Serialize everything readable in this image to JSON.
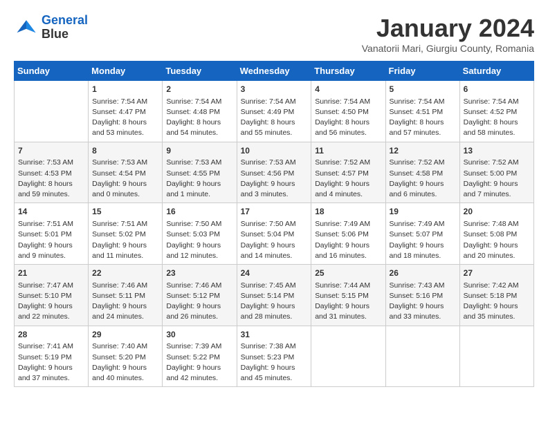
{
  "logo": {
    "line1": "General",
    "line2": "Blue"
  },
  "title": "January 2024",
  "location": "Vanatorii Mari, Giurgiu County, Romania",
  "weekdays": [
    "Sunday",
    "Monday",
    "Tuesday",
    "Wednesday",
    "Thursday",
    "Friday",
    "Saturday"
  ],
  "weeks": [
    [
      {
        "day": "",
        "info": ""
      },
      {
        "day": "1",
        "info": "Sunrise: 7:54 AM\nSunset: 4:47 PM\nDaylight: 8 hours\nand 53 minutes."
      },
      {
        "day": "2",
        "info": "Sunrise: 7:54 AM\nSunset: 4:48 PM\nDaylight: 8 hours\nand 54 minutes."
      },
      {
        "day": "3",
        "info": "Sunrise: 7:54 AM\nSunset: 4:49 PM\nDaylight: 8 hours\nand 55 minutes."
      },
      {
        "day": "4",
        "info": "Sunrise: 7:54 AM\nSunset: 4:50 PM\nDaylight: 8 hours\nand 56 minutes."
      },
      {
        "day": "5",
        "info": "Sunrise: 7:54 AM\nSunset: 4:51 PM\nDaylight: 8 hours\nand 57 minutes."
      },
      {
        "day": "6",
        "info": "Sunrise: 7:54 AM\nSunset: 4:52 PM\nDaylight: 8 hours\nand 58 minutes."
      }
    ],
    [
      {
        "day": "7",
        "info": "Sunrise: 7:53 AM\nSunset: 4:53 PM\nDaylight: 8 hours\nand 59 minutes."
      },
      {
        "day": "8",
        "info": "Sunrise: 7:53 AM\nSunset: 4:54 PM\nDaylight: 9 hours\nand 0 minutes."
      },
      {
        "day": "9",
        "info": "Sunrise: 7:53 AM\nSunset: 4:55 PM\nDaylight: 9 hours\nand 1 minute."
      },
      {
        "day": "10",
        "info": "Sunrise: 7:53 AM\nSunset: 4:56 PM\nDaylight: 9 hours\nand 3 minutes."
      },
      {
        "day": "11",
        "info": "Sunrise: 7:52 AM\nSunset: 4:57 PM\nDaylight: 9 hours\nand 4 minutes."
      },
      {
        "day": "12",
        "info": "Sunrise: 7:52 AM\nSunset: 4:58 PM\nDaylight: 9 hours\nand 6 minutes."
      },
      {
        "day": "13",
        "info": "Sunrise: 7:52 AM\nSunset: 5:00 PM\nDaylight: 9 hours\nand 7 minutes."
      }
    ],
    [
      {
        "day": "14",
        "info": "Sunrise: 7:51 AM\nSunset: 5:01 PM\nDaylight: 9 hours\nand 9 minutes."
      },
      {
        "day": "15",
        "info": "Sunrise: 7:51 AM\nSunset: 5:02 PM\nDaylight: 9 hours\nand 11 minutes."
      },
      {
        "day": "16",
        "info": "Sunrise: 7:50 AM\nSunset: 5:03 PM\nDaylight: 9 hours\nand 12 minutes."
      },
      {
        "day": "17",
        "info": "Sunrise: 7:50 AM\nSunset: 5:04 PM\nDaylight: 9 hours\nand 14 minutes."
      },
      {
        "day": "18",
        "info": "Sunrise: 7:49 AM\nSunset: 5:06 PM\nDaylight: 9 hours\nand 16 minutes."
      },
      {
        "day": "19",
        "info": "Sunrise: 7:49 AM\nSunset: 5:07 PM\nDaylight: 9 hours\nand 18 minutes."
      },
      {
        "day": "20",
        "info": "Sunrise: 7:48 AM\nSunset: 5:08 PM\nDaylight: 9 hours\nand 20 minutes."
      }
    ],
    [
      {
        "day": "21",
        "info": "Sunrise: 7:47 AM\nSunset: 5:10 PM\nDaylight: 9 hours\nand 22 minutes."
      },
      {
        "day": "22",
        "info": "Sunrise: 7:46 AM\nSunset: 5:11 PM\nDaylight: 9 hours\nand 24 minutes."
      },
      {
        "day": "23",
        "info": "Sunrise: 7:46 AM\nSunset: 5:12 PM\nDaylight: 9 hours\nand 26 minutes."
      },
      {
        "day": "24",
        "info": "Sunrise: 7:45 AM\nSunset: 5:14 PM\nDaylight: 9 hours\nand 28 minutes."
      },
      {
        "day": "25",
        "info": "Sunrise: 7:44 AM\nSunset: 5:15 PM\nDaylight: 9 hours\nand 31 minutes."
      },
      {
        "day": "26",
        "info": "Sunrise: 7:43 AM\nSunset: 5:16 PM\nDaylight: 9 hours\nand 33 minutes."
      },
      {
        "day": "27",
        "info": "Sunrise: 7:42 AM\nSunset: 5:18 PM\nDaylight: 9 hours\nand 35 minutes."
      }
    ],
    [
      {
        "day": "28",
        "info": "Sunrise: 7:41 AM\nSunset: 5:19 PM\nDaylight: 9 hours\nand 37 minutes."
      },
      {
        "day": "29",
        "info": "Sunrise: 7:40 AM\nSunset: 5:20 PM\nDaylight: 9 hours\nand 40 minutes."
      },
      {
        "day": "30",
        "info": "Sunrise: 7:39 AM\nSunset: 5:22 PM\nDaylight: 9 hours\nand 42 minutes."
      },
      {
        "day": "31",
        "info": "Sunrise: 7:38 AM\nSunset: 5:23 PM\nDaylight: 9 hours\nand 45 minutes."
      },
      {
        "day": "",
        "info": ""
      },
      {
        "day": "",
        "info": ""
      },
      {
        "day": "",
        "info": ""
      }
    ]
  ]
}
